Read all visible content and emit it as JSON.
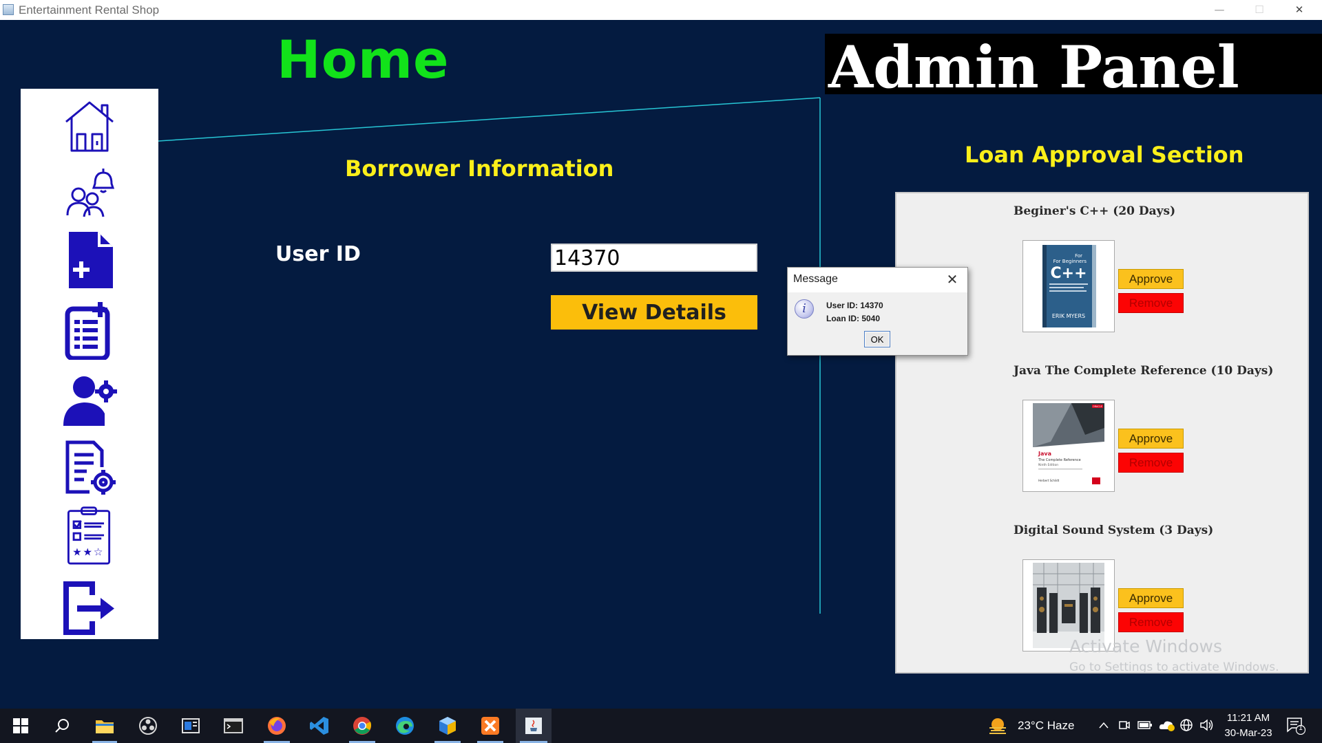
{
  "window": {
    "title": "Entertainment Rental Shop",
    "minimize": "—",
    "maximize": "☐",
    "close": "✕"
  },
  "home_title": "Home",
  "admin_title": "Admin Panel",
  "sidebar": {
    "items": [
      {
        "icon": "home-icon"
      },
      {
        "icon": "users-notification-icon"
      },
      {
        "icon": "add-document-icon"
      },
      {
        "icon": "add-list-icon"
      },
      {
        "icon": "user-settings-icon"
      },
      {
        "icon": "document-settings-icon"
      },
      {
        "icon": "rating-clipboard-icon"
      },
      {
        "icon": "logout-icon"
      }
    ]
  },
  "borrower": {
    "heading": "Borrower Information",
    "user_id_label": "User ID",
    "user_id_value": "14370",
    "view_button": "View Details"
  },
  "loan": {
    "heading": "Loan Approval Section",
    "items": [
      {
        "title": "Beginer's C++ (20 Days)",
        "cover_title": "C++",
        "cover_sub": "For Beginners",
        "cover_author": "ERIK MYERS",
        "approve": "Approve",
        "remove": "Remove"
      },
      {
        "title": "Java The Complete Reference (10 Days)",
        "cover_title": "Java",
        "cover_sub": "The Complete Reference",
        "cover_edition": "Ninth Edition",
        "cover_brand": "ORACLE",
        "cover_author": "Herbert Schildt",
        "approve": "Approve",
        "remove": "Remove"
      },
      {
        "title": "Digital Sound System (3 Days)",
        "approve": "Approve",
        "remove": "Remove"
      }
    ]
  },
  "dialog": {
    "title": "Message",
    "close": "✕",
    "icon": "i",
    "line1": "User ID: 14370",
    "line2": "Loan ID: 5040",
    "ok": "OK"
  },
  "watermark": {
    "line1": "Activate Windows",
    "line2": "Go to Settings to activate Windows."
  },
  "taskbar": {
    "weather": "23°C  Haze",
    "time": "11:21 AM",
    "date": "30-Mar-23",
    "notification_count": "1"
  },
  "colors": {
    "background": "#041b40",
    "home_green": "#12e21a",
    "heading_yellow": "#fbef1a",
    "button_yellow": "#fbbe0b",
    "remove_red": "#fc0404",
    "icon_blue": "#1c11b8"
  }
}
